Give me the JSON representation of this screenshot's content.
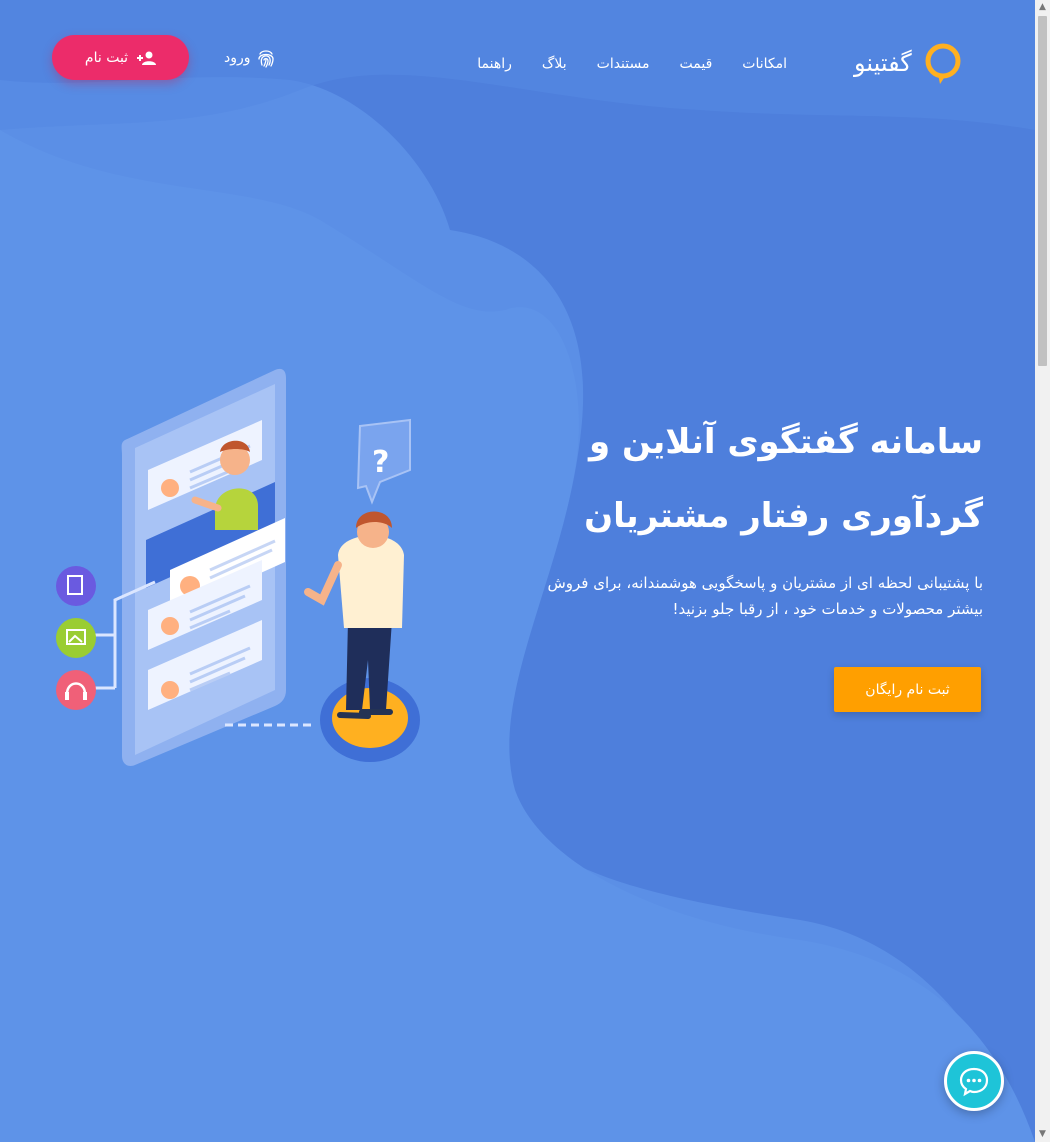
{
  "brand": {
    "name": "گفتینو"
  },
  "nav": {
    "items": [
      {
        "label": "امکانات"
      },
      {
        "label": "قیمت"
      },
      {
        "label": "مستندات"
      },
      {
        "label": "بلاگ"
      },
      {
        "label": "راهنما"
      }
    ],
    "login_label": "ورود",
    "signup_label": "ثبت نام"
  },
  "hero": {
    "title_line1": "سامانه گفتگوی آنلاین و",
    "title_line2": "گردآوری رفتار مشتریان",
    "subtitle": "با پشتیبانی لحظه ای از مشتریان و پاسخگویی هوشمندانه، برای فروش بیشتر محصولات و خدمات خود ، از رقبا جلو بزنید!",
    "cta_label": "ثبت نام رایگان"
  },
  "colors": {
    "background": "#5b8fe6",
    "accent": "#ec2c6a",
    "cta": "#ff9f00",
    "chat": "#1ec4d8"
  },
  "icons": [
    "fingerprint-icon",
    "person-add-icon",
    "chat-icon"
  ]
}
